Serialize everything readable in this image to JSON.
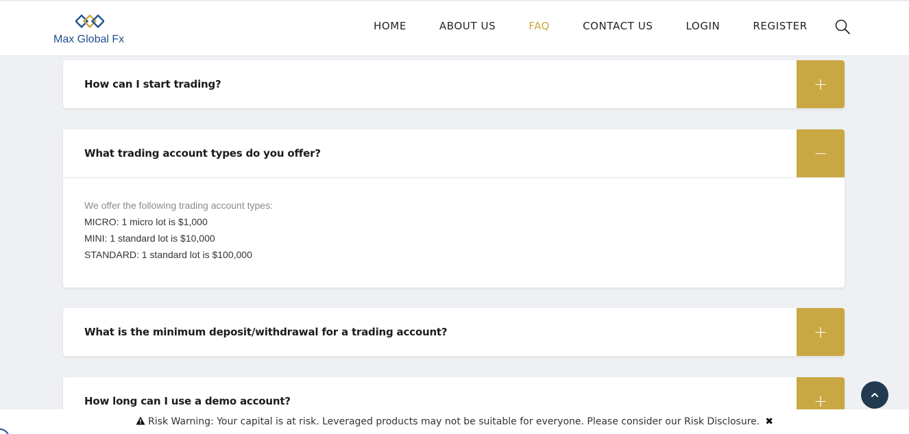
{
  "brand": {
    "name": "Max Global Fx"
  },
  "nav": {
    "items": [
      {
        "label": "HOME",
        "active": false
      },
      {
        "label": "ABOUT US",
        "active": false
      },
      {
        "label": "FAQ",
        "active": true
      },
      {
        "label": "CONTACT US",
        "active": false
      },
      {
        "label": "LOGIN",
        "active": false
      },
      {
        "label": "REGISTER",
        "active": false
      }
    ],
    "search_icon": "search-icon"
  },
  "faq": [
    {
      "question": "How can I start trading?",
      "expanded": false,
      "toggle": "+"
    },
    {
      "question": "What trading account types do you offer?",
      "expanded": true,
      "toggle": "−",
      "answer": [
        "We offer the following trading account types:",
        "MICRO: 1 micro lot is $1,000",
        "MINI: 1 standard lot is $10,000",
        "STANDARD: 1 standard lot is $100,000"
      ]
    },
    {
      "question": "What is the minimum deposit/withdrawal for a trading account?",
      "expanded": false,
      "toggle": "+"
    },
    {
      "question": "How long can I use a demo account?",
      "expanded": false,
      "toggle": "+"
    }
  ],
  "risk_warning": {
    "text": "Risk Warning: Your capital is at risk. Leveraged products may not be suitable for everyone. Please consider our Risk Disclosure.",
    "close": "✖"
  },
  "colors": {
    "accent": "#c9a843",
    "brand": "#1e4f8c",
    "back_to_top": "#213a4f"
  }
}
